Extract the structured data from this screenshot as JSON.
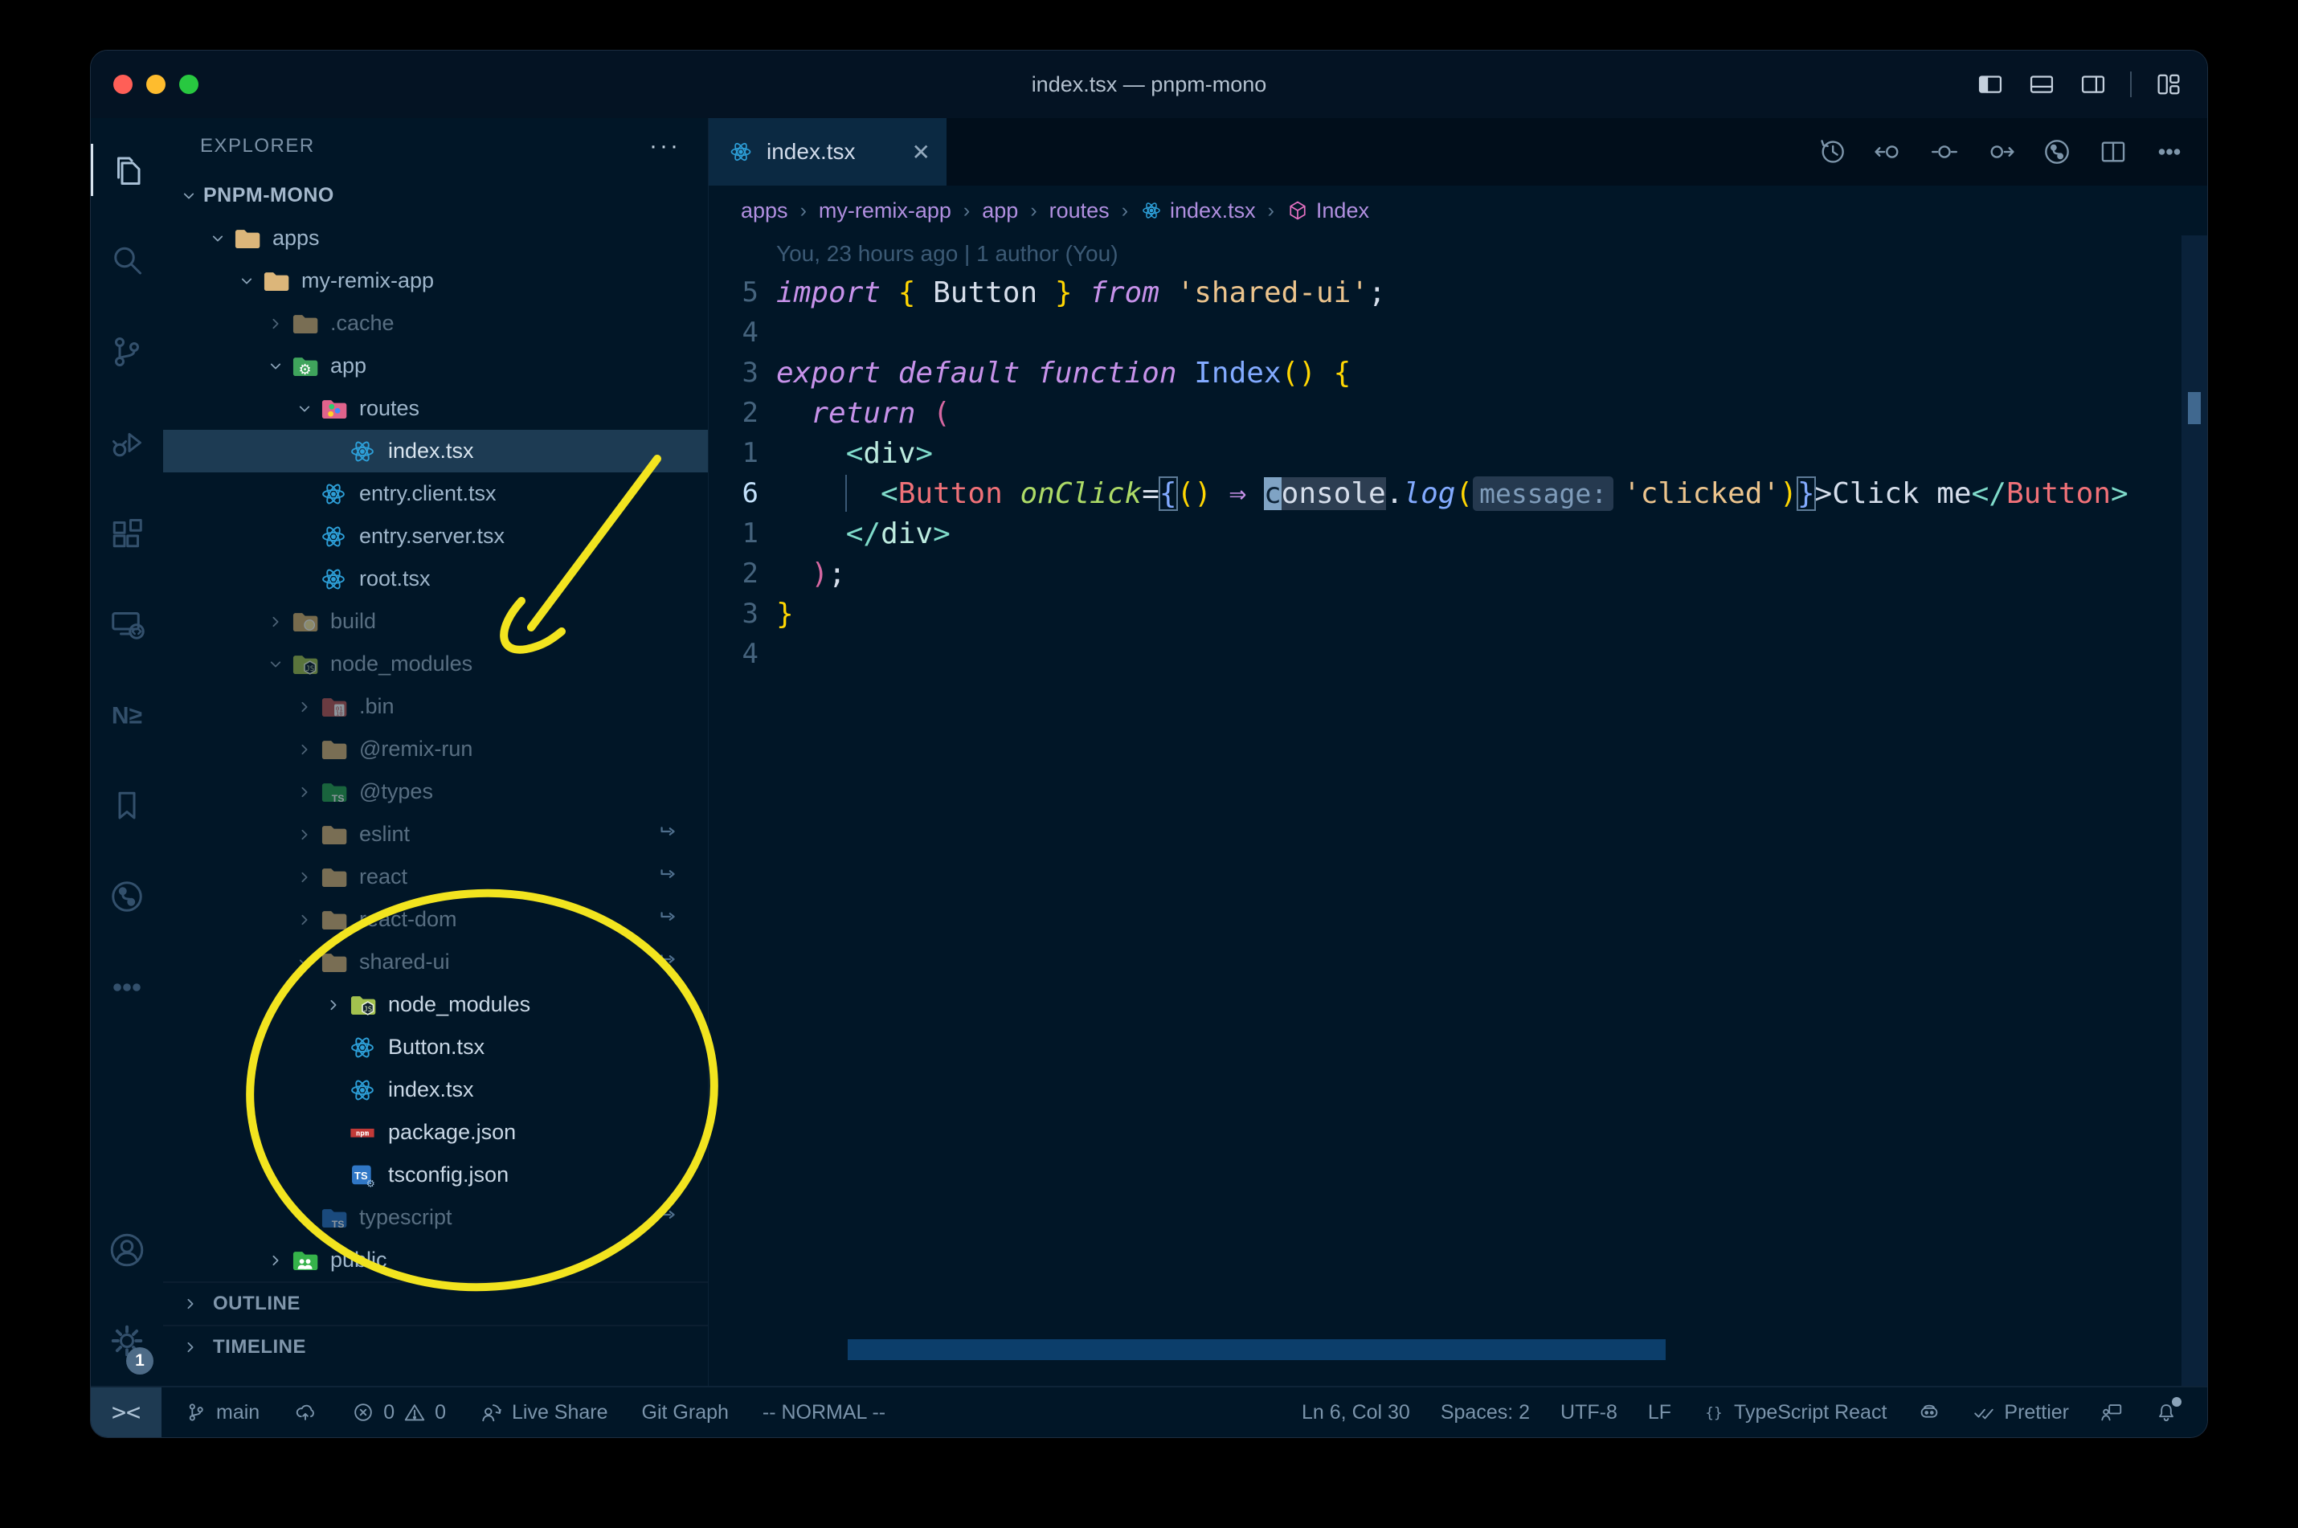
{
  "window": {
    "title": "index.tsx — pnpm-mono"
  },
  "titlebar_controls": [
    "layout-sidebar-left-icon",
    "layout-panel-icon",
    "layout-sidebar-right-icon",
    "sep",
    "layout-grid-icon"
  ],
  "activity_bar": {
    "top": [
      {
        "name": "explorer",
        "icon": "files",
        "active": true
      },
      {
        "name": "search",
        "icon": "search"
      },
      {
        "name": "source-control",
        "icon": "branch-lg"
      },
      {
        "name": "run-debug",
        "icon": "debug"
      },
      {
        "name": "extensions",
        "icon": "extensions"
      },
      {
        "name": "remote-explorer",
        "icon": "remote"
      },
      {
        "name": "nx-console",
        "icon": "nx"
      },
      {
        "name": "bookmarks",
        "icon": "bookmark"
      },
      {
        "name": "git-graph",
        "icon": "gitgraph"
      },
      {
        "name": "more",
        "icon": "ellipsis"
      }
    ],
    "bottom": [
      {
        "name": "accounts",
        "icon": "account"
      },
      {
        "name": "settings",
        "icon": "gear",
        "badge": "1"
      }
    ]
  },
  "explorer": {
    "header": "EXPLORER",
    "more": "···",
    "tree": [
      {
        "label": "PNPM-MONO",
        "lvl": 0,
        "chev": "down",
        "root": true
      },
      {
        "label": "apps",
        "lvl": 1,
        "icon": "folder",
        "chev": "down"
      },
      {
        "label": "my-remix-app",
        "lvl": 2,
        "icon": "folder",
        "chev": "down"
      },
      {
        "label": ".cache",
        "lvl": 3,
        "icon": "folder",
        "chev": "right",
        "dim": true
      },
      {
        "label": "app",
        "lvl": 3,
        "icon": "folder-app",
        "chev": "down"
      },
      {
        "label": "routes",
        "lvl": 4,
        "icon": "folder-routes",
        "chev": "down"
      },
      {
        "label": "index.tsx",
        "lvl": 5,
        "icon": "react",
        "selected": true
      },
      {
        "label": "entry.client.tsx",
        "lvl": 4,
        "icon": "react"
      },
      {
        "label": "entry.server.tsx",
        "lvl": 4,
        "icon": "react"
      },
      {
        "label": "root.tsx",
        "lvl": 4,
        "icon": "react"
      },
      {
        "label": "build",
        "lvl": 3,
        "icon": "folder-build",
        "chev": "right",
        "dim": true
      },
      {
        "label": "node_modules",
        "lvl": 3,
        "icon": "folder-nm",
        "chev": "down",
        "dim": true
      },
      {
        "label": ".bin",
        "lvl": 4,
        "icon": "folder-bin",
        "chev": "right",
        "dim": true
      },
      {
        "label": "@remix-run",
        "lvl": 4,
        "icon": "folder",
        "chev": "right",
        "dim": true
      },
      {
        "label": "@types",
        "lvl": 4,
        "icon": "folder-types",
        "chev": "right",
        "dim": true
      },
      {
        "label": "eslint",
        "lvl": 4,
        "icon": "folder",
        "chev": "right",
        "dim": true,
        "sym": true
      },
      {
        "label": "react",
        "lvl": 4,
        "icon": "folder",
        "chev": "right",
        "dim": true,
        "sym": true
      },
      {
        "label": "react-dom",
        "lvl": 4,
        "icon": "folder",
        "chev": "right",
        "dim": true,
        "sym": true
      },
      {
        "label": "shared-ui",
        "lvl": 4,
        "icon": "folder",
        "chev": "down",
        "dim": true,
        "sym": true
      },
      {
        "label": "node_modules",
        "lvl": 5,
        "icon": "folder-nm",
        "chev": "right",
        "bright": true
      },
      {
        "label": "Button.tsx",
        "lvl": 5,
        "icon": "react",
        "bright": true
      },
      {
        "label": "index.tsx",
        "lvl": 5,
        "icon": "react",
        "bright": true
      },
      {
        "label": "package.json",
        "lvl": 5,
        "icon": "npm",
        "bright": true
      },
      {
        "label": "tsconfig.json",
        "lvl": 5,
        "icon": "tsconfig",
        "bright": true
      },
      {
        "label": "typescript",
        "lvl": 4,
        "icon": "folder-ts",
        "chev": "right",
        "dim": true,
        "sym": true
      },
      {
        "label": "public",
        "lvl": 3,
        "icon": "folder-public",
        "chev": "right"
      }
    ],
    "sections": [
      "OUTLINE",
      "TIMELINE"
    ]
  },
  "editor": {
    "tab": {
      "label": "index.tsx",
      "icon": "react",
      "close": "✕"
    },
    "actions": [
      "history-icon",
      "prev-change-icon",
      "change-icon",
      "next-change-icon",
      "git-graph-icon",
      "split-editor-icon",
      "more-icon"
    ],
    "breadcrumbs": {
      "sep": "›",
      "items": [
        {
          "label": "apps"
        },
        {
          "label": "my-remix-app"
        },
        {
          "label": "app"
        },
        {
          "label": "routes"
        },
        {
          "label": "index.tsx",
          "icon": "react"
        },
        {
          "label": "Index",
          "icon": "symbol"
        }
      ]
    },
    "blame": "You, 23 hours ago | 1 author (You)",
    "code_lines": [
      {
        "num": "5",
        "tokens": [
          [
            "import",
            "kw"
          ],
          [
            " ",
            "sp"
          ],
          [
            "{",
            "gold"
          ],
          [
            " Button ",
            "fg"
          ],
          [
            "}",
            "gold"
          ],
          [
            " ",
            "sp"
          ],
          [
            "from",
            "kw"
          ],
          [
            " ",
            "sp"
          ],
          [
            "'shared-ui'",
            "str"
          ],
          [
            ";",
            "fg"
          ]
        ]
      },
      {
        "num": "4",
        "tokens": []
      },
      {
        "num": "3",
        "tokens": [
          [
            "export",
            "kw"
          ],
          [
            " ",
            "sp"
          ],
          [
            "default",
            "kw"
          ],
          [
            " ",
            "sp"
          ],
          [
            "function",
            "kw"
          ],
          [
            " ",
            "sp"
          ],
          [
            "Index",
            "blue"
          ],
          [
            "()",
            "gold"
          ],
          [
            " ",
            "sp"
          ],
          [
            "{",
            "gold"
          ]
        ]
      },
      {
        "num": "2",
        "tokens": [
          [
            "  ",
            "sp"
          ],
          [
            "return",
            "kw"
          ],
          [
            " ",
            "sp"
          ],
          [
            "(",
            "pink"
          ]
        ]
      },
      {
        "num": "1",
        "tokens": [
          [
            "    ",
            "sp"
          ],
          [
            "<",
            "teal"
          ],
          [
            "div",
            "tag"
          ],
          [
            ">",
            "teal"
          ]
        ]
      },
      {
        "num": "6",
        "current": true,
        "guide": true,
        "tokens": [
          [
            "      ",
            "sp"
          ],
          [
            "<",
            "teal"
          ],
          [
            "Button",
            "comp"
          ],
          [
            " ",
            "sp"
          ],
          [
            "onClick",
            "attr"
          ],
          [
            "=",
            "fg"
          ],
          [
            "{",
            "blue box"
          ],
          [
            "()",
            "gold"
          ],
          [
            " ",
            "sp"
          ],
          [
            "⇒",
            "kw"
          ],
          [
            " ",
            "sp"
          ],
          [
            "c",
            "cursor"
          ],
          [
            "onsole",
            "fg hl"
          ],
          [
            ".",
            "fg"
          ],
          [
            "log",
            "bluei"
          ],
          [
            "(",
            "gold"
          ],
          [
            "message:",
            "hint"
          ],
          [
            "'clicked'",
            "str"
          ],
          [
            ")",
            "gold"
          ],
          [
            "}",
            "blue box"
          ],
          [
            ">",
            "fg"
          ],
          [
            "Click me",
            "fg"
          ],
          [
            "</",
            "teal"
          ],
          [
            "Button",
            "comp"
          ],
          [
            ">",
            "teal"
          ]
        ]
      },
      {
        "num": "1",
        "tokens": [
          [
            "    ",
            "sp"
          ],
          [
            "</",
            "teal"
          ],
          [
            "div",
            "tag"
          ],
          [
            ">",
            "teal"
          ]
        ]
      },
      {
        "num": "2",
        "tokens": [
          [
            "  ",
            "sp"
          ],
          [
            ")",
            "pink"
          ],
          [
            ";",
            "fg"
          ]
        ]
      },
      {
        "num": "3",
        "tokens": [
          [
            "}",
            "gold"
          ]
        ]
      },
      {
        "num": "4",
        "tokens": []
      }
    ]
  },
  "status_bar": {
    "remote_icon": "><",
    "left": [
      {
        "name": "branch",
        "parts": [
          [
            "i",
            "branch"
          ],
          [
            "t",
            "main"
          ]
        ]
      },
      {
        "name": "sync",
        "parts": [
          [
            "i",
            "cloud"
          ]
        ]
      },
      {
        "name": "problems",
        "parts": [
          [
            "i",
            "error"
          ],
          [
            "t",
            "0"
          ],
          [
            "i",
            "warn"
          ],
          [
            "t",
            "0"
          ]
        ]
      },
      {
        "name": "live-share",
        "parts": [
          [
            "i",
            "liveshare"
          ],
          [
            "t",
            "Live Share"
          ]
        ]
      },
      {
        "name": "git-graph",
        "parts": [
          [
            "t",
            "Git Graph"
          ]
        ]
      },
      {
        "name": "vim-mode",
        "parts": [
          [
            "t",
            "-- NORMAL --"
          ]
        ]
      }
    ],
    "right": [
      {
        "name": "cursor-position",
        "parts": [
          [
            "t",
            "Ln 6, Col 30"
          ]
        ]
      },
      {
        "name": "indentation",
        "parts": [
          [
            "t",
            "Spaces: 2"
          ]
        ]
      },
      {
        "name": "encoding",
        "parts": [
          [
            "t",
            "UTF-8"
          ]
        ]
      },
      {
        "name": "eol",
        "parts": [
          [
            "t",
            "LF"
          ]
        ]
      },
      {
        "name": "language-mode",
        "parts": [
          [
            "i",
            "braces"
          ],
          [
            "t",
            "TypeScript React"
          ]
        ]
      },
      {
        "name": "copilot",
        "parts": [
          [
            "i",
            "copilot"
          ]
        ]
      },
      {
        "name": "formatter",
        "parts": [
          [
            "i",
            "checks"
          ],
          [
            "t",
            "Prettier"
          ]
        ]
      },
      {
        "name": "feedback",
        "parts": [
          [
            "i",
            "feedback"
          ]
        ]
      },
      {
        "name": "notifications",
        "parts": [
          [
            "i",
            "bell"
          ],
          [
            "dot",
            "1"
          ]
        ]
      }
    ]
  },
  "annotation": {
    "color": "#f2e41f"
  },
  "theme": {
    "background": "#011627",
    "selection": "#1d3b53",
    "active_tab": "#0b2942",
    "traffic_lights": [
      "#ff5f57",
      "#febc2e",
      "#28c840"
    ]
  }
}
